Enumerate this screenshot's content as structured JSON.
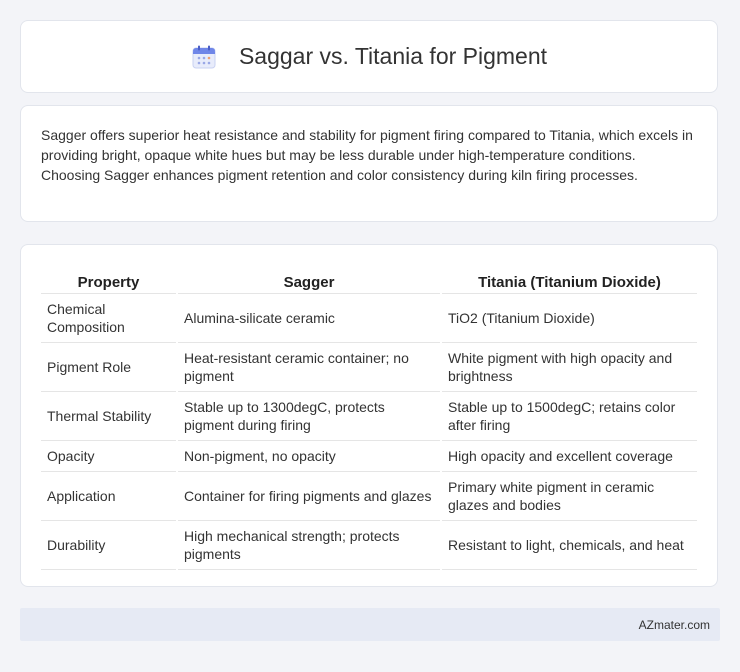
{
  "header": {
    "title": "Saggar vs. Titania for Pigment",
    "icon": "calendar-icon"
  },
  "summary": {
    "text": "Sagger offers superior heat resistance and stability for pigment firing compared to Titania, which excels in providing bright, opaque white hues but may be less durable under high-temperature conditions. Choosing Sagger enhances pigment retention and color consistency during kiln firing processes."
  },
  "table": {
    "headers": [
      "Property",
      "Sagger",
      "Titania (Titanium Dioxide)"
    ],
    "rows": [
      [
        "Chemical Composition",
        "Alumina-silicate ceramic",
        "TiO2 (Titanium Dioxide)"
      ],
      [
        "Pigment Role",
        "Heat-resistant ceramic container; no pigment",
        "White pigment with high opacity and brightness"
      ],
      [
        "Thermal Stability",
        "Stable up to 1300degC, protects pigment during firing",
        "Stable up to 1500degC; retains color after firing"
      ],
      [
        "Opacity",
        "Non-pigment, no opacity",
        "High opacity and excellent coverage"
      ],
      [
        "Application",
        "Container for firing pigments and glazes",
        "Primary white pigment in ceramic glazes and bodies"
      ],
      [
        "Durability",
        "High mechanical strength; protects pigments",
        "Resistant to light, chemicals, and heat"
      ]
    ]
  },
  "footer": {
    "brand": "AZmater.com"
  }
}
